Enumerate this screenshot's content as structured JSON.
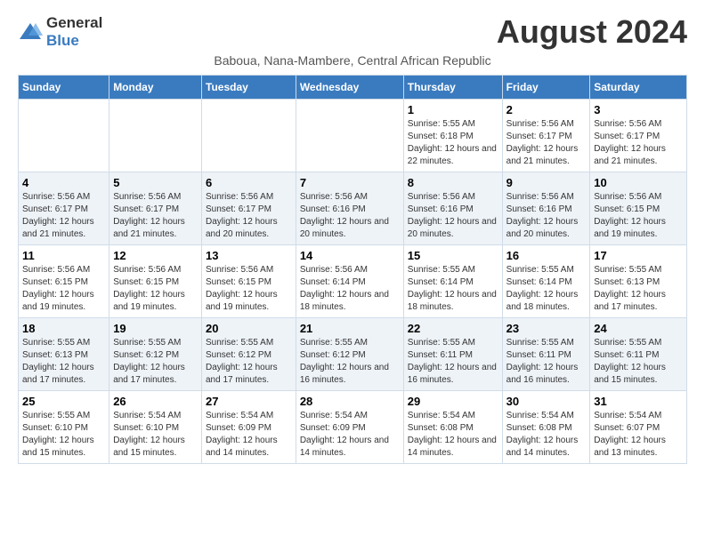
{
  "logo": {
    "text_general": "General",
    "text_blue": "Blue"
  },
  "title": "August 2024",
  "subtitle": "Baboua, Nana-Mambere, Central African Republic",
  "headers": [
    "Sunday",
    "Monday",
    "Tuesday",
    "Wednesday",
    "Thursday",
    "Friday",
    "Saturday"
  ],
  "weeks": [
    [
      {
        "day": "",
        "info": ""
      },
      {
        "day": "",
        "info": ""
      },
      {
        "day": "",
        "info": ""
      },
      {
        "day": "",
        "info": ""
      },
      {
        "day": "1",
        "info": "Sunrise: 5:55 AM\nSunset: 6:18 PM\nDaylight: 12 hours and 22 minutes."
      },
      {
        "day": "2",
        "info": "Sunrise: 5:56 AM\nSunset: 6:17 PM\nDaylight: 12 hours and 21 minutes."
      },
      {
        "day": "3",
        "info": "Sunrise: 5:56 AM\nSunset: 6:17 PM\nDaylight: 12 hours and 21 minutes."
      }
    ],
    [
      {
        "day": "4",
        "info": "Sunrise: 5:56 AM\nSunset: 6:17 PM\nDaylight: 12 hours and 21 minutes."
      },
      {
        "day": "5",
        "info": "Sunrise: 5:56 AM\nSunset: 6:17 PM\nDaylight: 12 hours and 21 minutes."
      },
      {
        "day": "6",
        "info": "Sunrise: 5:56 AM\nSunset: 6:17 PM\nDaylight: 12 hours and 20 minutes."
      },
      {
        "day": "7",
        "info": "Sunrise: 5:56 AM\nSunset: 6:16 PM\nDaylight: 12 hours and 20 minutes."
      },
      {
        "day": "8",
        "info": "Sunrise: 5:56 AM\nSunset: 6:16 PM\nDaylight: 12 hours and 20 minutes."
      },
      {
        "day": "9",
        "info": "Sunrise: 5:56 AM\nSunset: 6:16 PM\nDaylight: 12 hours and 20 minutes."
      },
      {
        "day": "10",
        "info": "Sunrise: 5:56 AM\nSunset: 6:15 PM\nDaylight: 12 hours and 19 minutes."
      }
    ],
    [
      {
        "day": "11",
        "info": "Sunrise: 5:56 AM\nSunset: 6:15 PM\nDaylight: 12 hours and 19 minutes."
      },
      {
        "day": "12",
        "info": "Sunrise: 5:56 AM\nSunset: 6:15 PM\nDaylight: 12 hours and 19 minutes."
      },
      {
        "day": "13",
        "info": "Sunrise: 5:56 AM\nSunset: 6:15 PM\nDaylight: 12 hours and 19 minutes."
      },
      {
        "day": "14",
        "info": "Sunrise: 5:56 AM\nSunset: 6:14 PM\nDaylight: 12 hours and 18 minutes."
      },
      {
        "day": "15",
        "info": "Sunrise: 5:55 AM\nSunset: 6:14 PM\nDaylight: 12 hours and 18 minutes."
      },
      {
        "day": "16",
        "info": "Sunrise: 5:55 AM\nSunset: 6:14 PM\nDaylight: 12 hours and 18 minutes."
      },
      {
        "day": "17",
        "info": "Sunrise: 5:55 AM\nSunset: 6:13 PM\nDaylight: 12 hours and 17 minutes."
      }
    ],
    [
      {
        "day": "18",
        "info": "Sunrise: 5:55 AM\nSunset: 6:13 PM\nDaylight: 12 hours and 17 minutes."
      },
      {
        "day": "19",
        "info": "Sunrise: 5:55 AM\nSunset: 6:12 PM\nDaylight: 12 hours and 17 minutes."
      },
      {
        "day": "20",
        "info": "Sunrise: 5:55 AM\nSunset: 6:12 PM\nDaylight: 12 hours and 17 minutes."
      },
      {
        "day": "21",
        "info": "Sunrise: 5:55 AM\nSunset: 6:12 PM\nDaylight: 12 hours and 16 minutes."
      },
      {
        "day": "22",
        "info": "Sunrise: 5:55 AM\nSunset: 6:11 PM\nDaylight: 12 hours and 16 minutes."
      },
      {
        "day": "23",
        "info": "Sunrise: 5:55 AM\nSunset: 6:11 PM\nDaylight: 12 hours and 16 minutes."
      },
      {
        "day": "24",
        "info": "Sunrise: 5:55 AM\nSunset: 6:11 PM\nDaylight: 12 hours and 15 minutes."
      }
    ],
    [
      {
        "day": "25",
        "info": "Sunrise: 5:55 AM\nSunset: 6:10 PM\nDaylight: 12 hours and 15 minutes."
      },
      {
        "day": "26",
        "info": "Sunrise: 5:54 AM\nSunset: 6:10 PM\nDaylight: 12 hours and 15 minutes."
      },
      {
        "day": "27",
        "info": "Sunrise: 5:54 AM\nSunset: 6:09 PM\nDaylight: 12 hours and 14 minutes."
      },
      {
        "day": "28",
        "info": "Sunrise: 5:54 AM\nSunset: 6:09 PM\nDaylight: 12 hours and 14 minutes."
      },
      {
        "day": "29",
        "info": "Sunrise: 5:54 AM\nSunset: 6:08 PM\nDaylight: 12 hours and 14 minutes."
      },
      {
        "day": "30",
        "info": "Sunrise: 5:54 AM\nSunset: 6:08 PM\nDaylight: 12 hours and 14 minutes."
      },
      {
        "day": "31",
        "info": "Sunrise: 5:54 AM\nSunset: 6:07 PM\nDaylight: 12 hours and 13 minutes."
      }
    ]
  ]
}
